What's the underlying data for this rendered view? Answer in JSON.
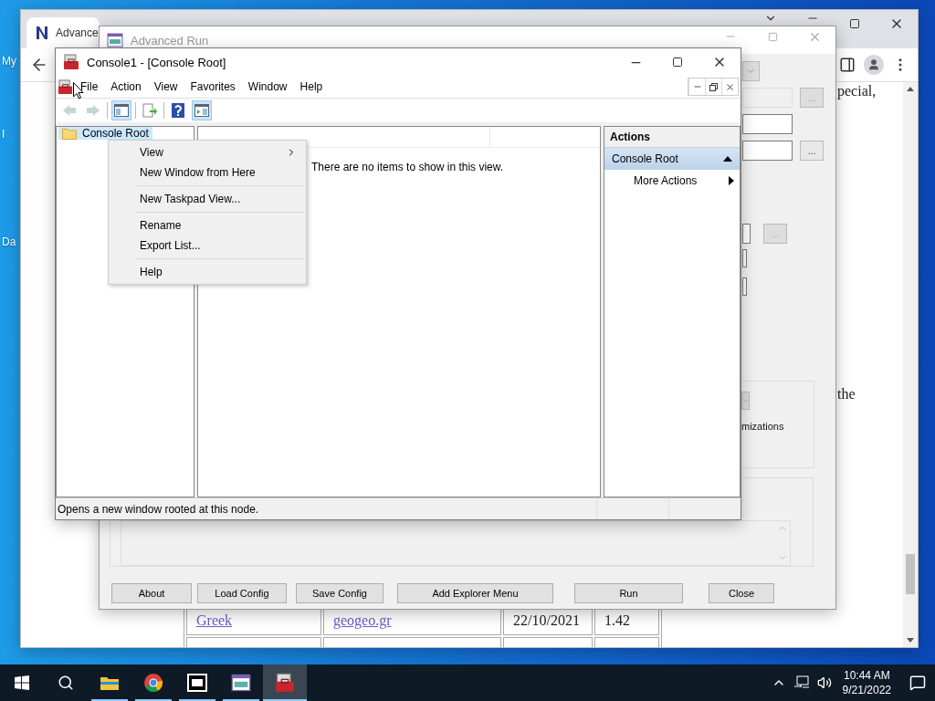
{
  "desktop": {
    "icon_labels": [
      "My",
      "I",
      "Da"
    ]
  },
  "browser": {
    "tab_title": "Advance",
    "side_texts": [
      "pecial,",
      "the"
    ],
    "table_rows": [
      [
        "Greek",
        "geogeo.gr",
        "22/10/2021",
        "1.42"
      ]
    ]
  },
  "advanced_run": {
    "title": "Advanced Run",
    "browse_buttons": [
      "...",
      "...",
      "..."
    ],
    "option_text": "mizations",
    "buttons": [
      "About",
      "Load Config",
      "Save Config",
      "Add Explorer Menu",
      "Run",
      "Close"
    ]
  },
  "console": {
    "title": "Console1 - [Console Root]",
    "menu": [
      "File",
      "Action",
      "View",
      "Favorites",
      "Window",
      "Help"
    ],
    "toolbar": [
      {
        "kind": "back",
        "pressed": false,
        "disabled": true
      },
      {
        "kind": "forward",
        "pressed": false,
        "disabled": true
      },
      {
        "kind": "tree",
        "pressed": true,
        "disabled": false
      },
      {
        "kind": "export",
        "pressed": false,
        "disabled": false
      },
      {
        "kind": "help",
        "pressed": false,
        "disabled": false
      },
      {
        "kind": "actionpane",
        "pressed": true,
        "disabled": false
      }
    ],
    "tree": [
      {
        "label": "Console Root",
        "selected": true
      }
    ],
    "empty_message": "There are no items to show in this view.",
    "actions": {
      "header": "Actions",
      "group": "Console Root",
      "expanded": true,
      "items": [
        "More Actions"
      ]
    },
    "status": "Opens a new window rooted at this node."
  },
  "context_menu": {
    "items": [
      {
        "kind": "item",
        "label": "View",
        "submenu": true
      },
      {
        "kind": "item",
        "label": "New Window from Here",
        "submenu": false
      },
      {
        "kind": "separator"
      },
      {
        "kind": "item",
        "label": "New Taskpad View...",
        "submenu": false
      },
      {
        "kind": "separator"
      },
      {
        "kind": "item",
        "label": "Rename",
        "submenu": false
      },
      {
        "kind": "item",
        "label": "Export List...",
        "submenu": false
      },
      {
        "kind": "separator"
      },
      {
        "kind": "item",
        "label": "Help",
        "submenu": false
      }
    ]
  },
  "taskbar": {
    "apps": [
      {
        "kind": "explorer",
        "active": false
      },
      {
        "kind": "chrome",
        "active": false
      },
      {
        "kind": "archive",
        "active": false
      },
      {
        "kind": "advancedrun",
        "active": false
      },
      {
        "kind": "console",
        "active": true
      }
    ],
    "time": "10:44 AM",
    "date": "9/21/2022"
  }
}
